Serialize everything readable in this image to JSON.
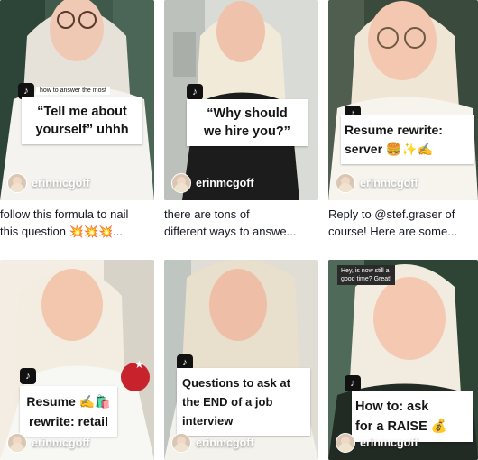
{
  "videos": [
    {
      "caption_lines": [
        "“Tell me about",
        "yourself” uhhh"
      ],
      "top_tag": "how to answer the most",
      "username": "erinmcgoff",
      "description": [
        "follow this formula to nail",
        "this question 💥💥💥..."
      ],
      "icon": "tiktok-logo-icon"
    },
    {
      "caption_lines": [
        "“Why should",
        "we hire you?”"
      ],
      "username": "erinmcgoff",
      "description": [
        "there are tons of",
        "different ways to answe..."
      ],
      "icon": "tiktok-logo-icon"
    },
    {
      "caption_lines": [
        "Resume rewrite:",
        "server 🍔✨✍️"
      ],
      "username": "erinmcgoff",
      "description": [
        "Reply to @stef.graser of",
        "course! Here are some..."
      ],
      "icon": "tiktok-logo-icon"
    },
    {
      "caption_lines": [
        "Resume ✍️🛍️",
        "rewrite: retail"
      ],
      "username": "erinmcgoff",
      "icon": "tiktok-logo-icon"
    },
    {
      "caption_lines": [
        "Questions to ask at",
        "the END of a job",
        "interview"
      ],
      "username": "erinmcgoff",
      "icon": "tiktok-logo-icon"
    },
    {
      "caption_lines": [
        "How to: ask",
        "for a RAISE 💰"
      ],
      "top_tag_lines": [
        "Hey, is now still a",
        "good time? Great!"
      ],
      "username": "erinmcgoff",
      "icon": "tiktok-logo-icon"
    }
  ]
}
